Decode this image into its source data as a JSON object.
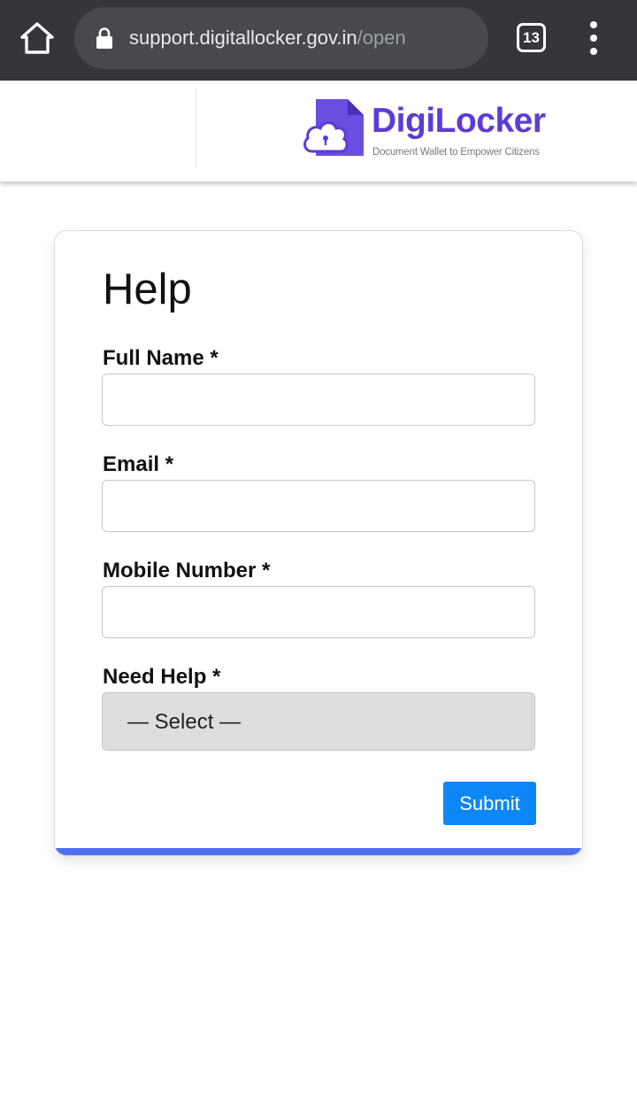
{
  "browser": {
    "url_host": "support.digitallocker.gov.in",
    "url_path": "/open",
    "tab_count": "13",
    "icons": {
      "home": "home-icon",
      "lock": "lock-icon",
      "menu": "more-vert-icon"
    }
  },
  "header": {
    "logo_title": "DigiLocker",
    "logo_tagline": "Document Wallet to Empower Citizens",
    "colors": {
      "brand": "#5c3bd6"
    }
  },
  "form": {
    "title": "Help",
    "fields": [
      {
        "label": "Full Name *",
        "value": "",
        "placeholder": ""
      },
      {
        "label": "Email *",
        "value": "",
        "placeholder": ""
      },
      {
        "label": "Mobile Number *",
        "value": "",
        "placeholder": ""
      }
    ],
    "need_help": {
      "label": "Need Help *",
      "selected": "— Select —"
    },
    "submit_label": "Submit",
    "colors": {
      "submit": "#0d86f7",
      "accent_bar": "#4f6ef0"
    }
  }
}
